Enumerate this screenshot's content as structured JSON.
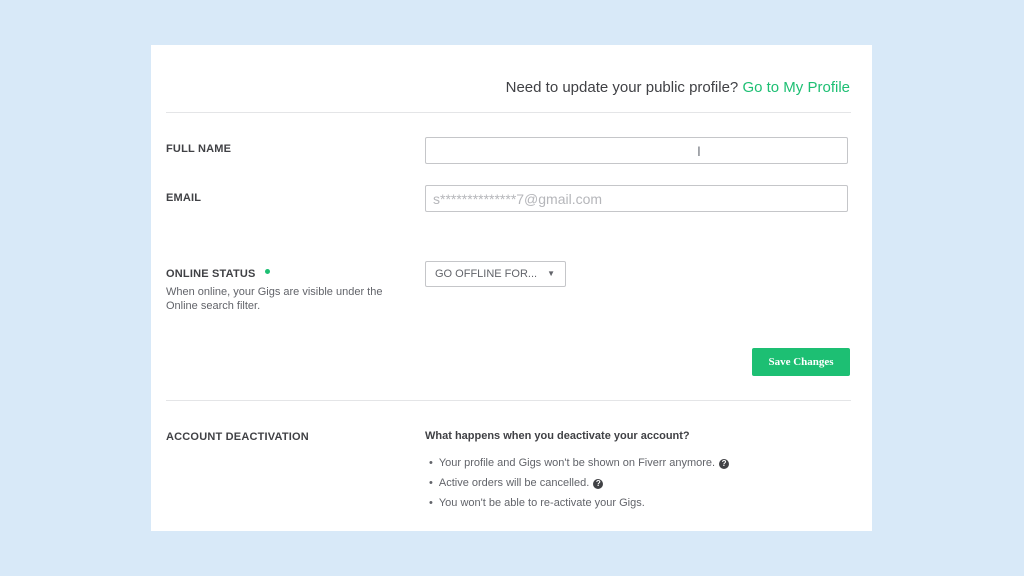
{
  "header": {
    "question": "Need to update your public profile?",
    "profile_link": "Go to My Profile"
  },
  "form": {
    "full_name": {
      "label": "FULL NAME",
      "value": ""
    },
    "email": {
      "label": "EMAIL",
      "placeholder": "s**************7@gmail.com"
    },
    "online_status": {
      "label": "ONLINE STATUS",
      "status_color": "#1dbf73",
      "description": "When online, your Gigs are visible under the Online search filter.",
      "select_value": "GO OFFLINE FOR...",
      "arrow_icon": "▼"
    },
    "save_label": "Save Changes"
  },
  "deactivation": {
    "label": "ACCOUNT DEACTIVATION",
    "title": "What happens when you deactivate your account?",
    "items": [
      {
        "text": "Your profile and Gigs won't be shown on Fiverr anymore.",
        "help": true
      },
      {
        "text": "Active orders will be cancelled.",
        "help": true
      },
      {
        "text": "You won't be able to re-activate your Gigs.",
        "help": false
      }
    ],
    "help_icon": "?"
  },
  "colors": {
    "accent": "#1dbf73",
    "background": "#d8e9f8"
  }
}
